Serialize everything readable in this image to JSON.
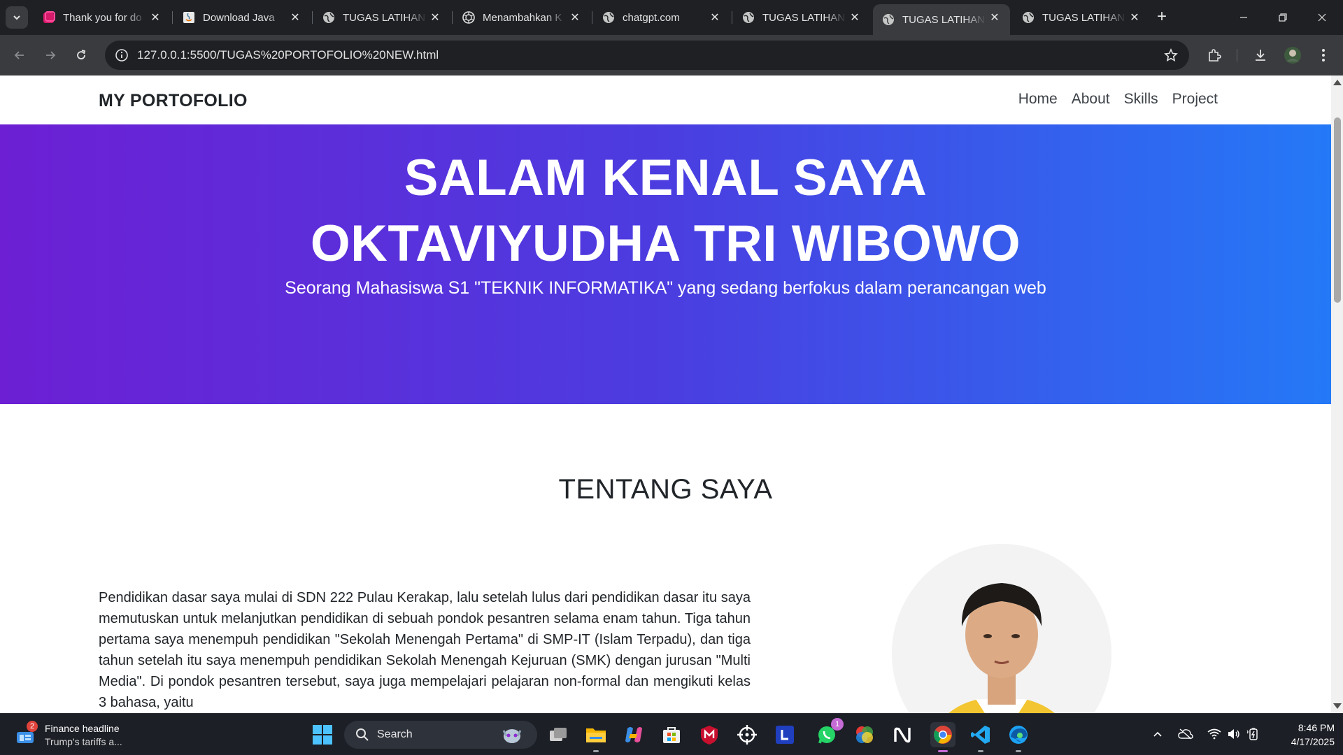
{
  "browser": {
    "tabs": [
      {
        "title": "Thank you for do",
        "icon": "app-icon-pink",
        "active": false
      },
      {
        "title": "Download Java",
        "icon": "java-icon",
        "active": false
      },
      {
        "title": "TUGAS LATIHAN",
        "icon": "globe-icon",
        "active": false
      },
      {
        "title": "Menambahkan K",
        "icon": "openai-icon",
        "active": false
      },
      {
        "title": "chatgpt.com",
        "icon": "globe-icon",
        "active": false
      },
      {
        "title": "TUGAS LATIHAN",
        "icon": "globe-icon",
        "active": false
      },
      {
        "title": "TUGAS LATIHAN",
        "icon": "globe-icon",
        "active": true
      },
      {
        "title": "TUGAS LATIHAN",
        "icon": "globe-icon",
        "active": false
      }
    ],
    "url": "127.0.0.1:5500/TUGAS%20PORTOFOLIO%20NEW.html"
  },
  "site": {
    "brand": "MY PORTOFOLIO",
    "nav": [
      "Home",
      "About",
      "Skills",
      "Project"
    ],
    "hero": {
      "line1": "SALAM KENAL SAYA",
      "line2": "OKTAVIYUDHA TRI WIBOWO",
      "subtitle": "Seorang Mahasiswa S1 \"TEKNIK INFORMATIKA\" yang sedang berfokus dalam perancangan web"
    },
    "about": {
      "title": "TENTANG SAYA",
      "text": "Pendidikan dasar saya mulai di SDN 222 Pulau Kerakap, lalu setelah lulus dari pendidikan dasar itu saya memutuskan untuk melanjutkan pendidikan di sebuah pondok pesantren selama enam tahun. Tiga tahun pertama saya menempuh pendidikan \"Sekolah Menengah Pertama\" di SMP-IT (Islam Terpadu), dan tiga tahun setelah itu saya menempuh pendidikan Sekolah Menengah Kejuruan (SMK) dengan jurusan \"Multi Media\". Di pondok pesantren tersebut, saya juga mempelajari pelajaran non-formal dan mengikuti kelas 3 bahasa, yaitu"
    },
    "colors": {
      "hero_start": "#6d1fd4",
      "hero_end": "#2479f7"
    }
  },
  "taskbar": {
    "news_badge": "2",
    "news_title": "Finance headline",
    "news_sub": "Trump's tariffs a...",
    "search_label": "Search",
    "whatsapp_badge": "1",
    "time": "8:46 PM",
    "date": "4/17/2025"
  }
}
